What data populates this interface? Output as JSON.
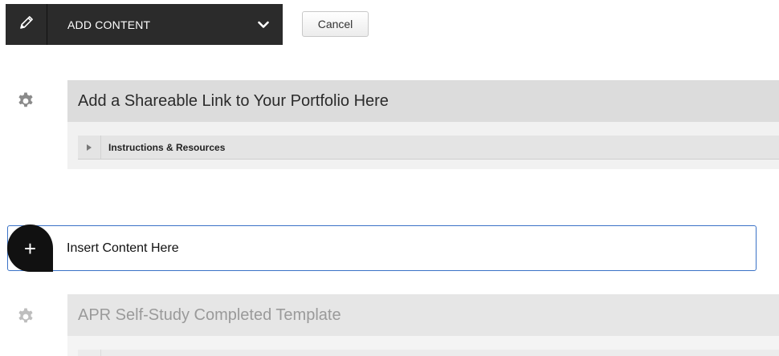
{
  "toolbar": {
    "add_content_label": "ADD CONTENT",
    "cancel_label": "Cancel"
  },
  "items": [
    {
      "title": "Add a Shareable Link to Your Portfolio Here",
      "sub_label": "Instructions & Resources"
    },
    {
      "title": "APR Self-Study Completed Template"
    }
  ],
  "insert": {
    "label": "Insert Content Here",
    "icon_glyph": "+"
  },
  "colors": {
    "toolbar_bg": "#2b2b2b",
    "insert_border": "#3a72c6",
    "gear": "#8a8a8a"
  },
  "icons": [
    "pencil-icon",
    "chevron-down-icon",
    "gear-icon",
    "caret-right-icon",
    "plus-icon"
  ]
}
